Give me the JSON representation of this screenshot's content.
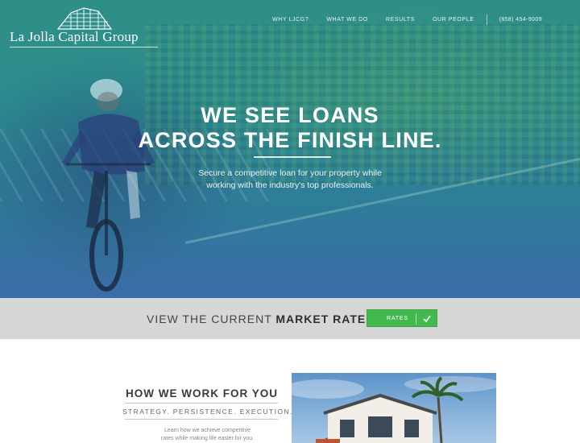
{
  "logo": {
    "text": "La Jolla Capital Group"
  },
  "nav": {
    "items": [
      "WHY LJCG?",
      "WHAT WE DO",
      "RESULTS",
      "OUR PEOPLE"
    ],
    "phone": "(858) 454-9009"
  },
  "hero": {
    "headline_line1": "WE SEE LOANS",
    "headline_line2": "ACROSS THE FINISH LINE.",
    "subhead_line1": "Secure a competitive loan for your property while",
    "subhead_line2": "working with the industry's top professionals."
  },
  "rates": {
    "text_prefix": "VIEW THE CURRENT",
    "text_bold": "MARKET RATES",
    "button_label": "RATES"
  },
  "how": {
    "title": "HOW WE WORK FOR YOU",
    "tagline": "STRATEGY. PERSISTENCE. EXECUTION.",
    "body_line1": "Learn how we achieve competitive",
    "body_line2": "rates while making life easier for you."
  },
  "colors": {
    "hero_teal": "#2b8c8f",
    "hero_blue": "#3b6ba8",
    "rates_bar": "#d6d6d6",
    "rates_button": "#43b84e"
  }
}
